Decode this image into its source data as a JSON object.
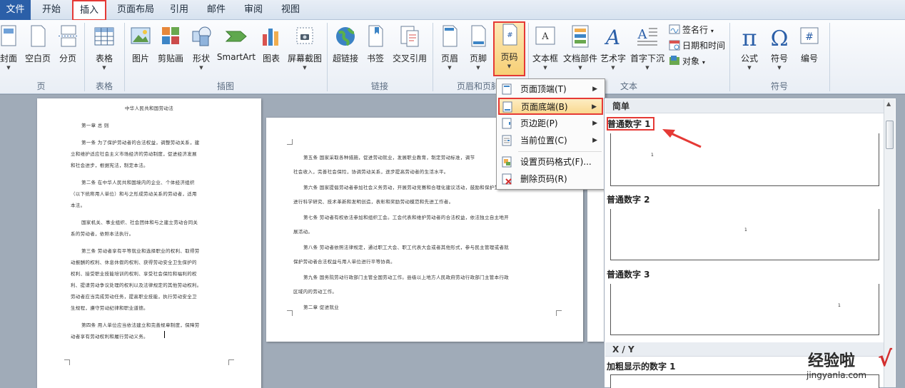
{
  "tabs": [
    "文件",
    "开始",
    "插入",
    "页面布局",
    "引用",
    "邮件",
    "审阅",
    "视图"
  ],
  "ribbon": {
    "page_group": {
      "label": "页",
      "cover": "封面",
      "blank": "空白页",
      "break": "分页"
    },
    "table_group": {
      "label": "表格",
      "table": "表格"
    },
    "illustrations_group": {
      "label": "插图",
      "picture": "图片",
      "clipart": "剪贴画",
      "shapes": "形状",
      "smartart": "SmartArt",
      "chart": "图表",
      "screenshot": "屏幕截图"
    },
    "links_group": {
      "label": "链接",
      "hyperlink": "超链接",
      "bookmark": "书签",
      "crossref": "交叉引用"
    },
    "hf_group": {
      "label": "页眉和页脚",
      "header": "页眉",
      "footer": "页脚",
      "pagenum": "页码"
    },
    "text_group": {
      "label": "文本",
      "textbox": "文本框",
      "quickparts": "文档部件",
      "wordart": "艺术字",
      "dropcap": "首字下沉",
      "signature": "签名行",
      "datetime": "日期和时间",
      "object": "对象"
    },
    "symbols_group": {
      "label": "符号",
      "equation": "公式",
      "symbol": "符号",
      "number": "编号"
    }
  },
  "page_num_menu": [
    {
      "label": "页面顶端(T)",
      "submenu": true
    },
    {
      "label": "页面底端(B)",
      "submenu": true,
      "highlighted": true
    },
    {
      "label": "页边距(P)",
      "submenu": true
    },
    {
      "label": "当前位置(C)",
      "submenu": true
    },
    {
      "label": "设置页码格式(F)...",
      "submenu": false
    },
    {
      "label": "删除页码(R)",
      "submenu": false
    }
  ],
  "gallery": {
    "section1": "简单",
    "items": [
      "普通数字 1",
      "普通数字 2",
      "普通数字 3"
    ],
    "section2": "X / Y",
    "item4": "加粗显示的数字 1",
    "thumb_number": "1"
  },
  "document": {
    "page1": [
      "中华人民共和国劳动法",
      "第一章  总  则",
      "第一条  为了保护劳动者的合法权益，调整劳动关系，建",
      "立和维护适应社会主义市场经济的劳动制度，促进经济发展",
      "和社会进步，根据宪法，制定本法。",
      "第二条  在中华人民共和国境内的企业、个体经济组织",
      "（以下统称用人单位）和与之形成劳动关系的劳动者，适用",
      "本法。",
      "国家机关、事业组织、社会团体和与之建立劳动合同关",
      "系的劳动者，依照本法执行。",
      "第三条  劳动者享有平等就业和选择职业的权利、取得劳",
      "动报酬的权利、休息休假的权利、获得劳动安全卫生保护的",
      "权利、接受职业技能培训的权利、享受社会保险和福利的权",
      "利、提请劳动争议处理的权利以及法律规定的其他劳动权利。",
      "劳动者应当完成劳动任务，提高职业技能，执行劳动安全卫",
      "生规程，遵守劳动纪律和职业道德。",
      "第四条  用人单位应当依法建立和完善规章制度，保障劳",
      "动者享有劳动权利和履行劳动义务。"
    ],
    "page2": [
      "第五条  国家采取各种措施，促进劳动就业，发展职业教育，制定劳动标准，调节",
      "社会收入，完善社会保险，协调劳动关系，逐步提高劳动者的生活水平。",
      "第六条  国家提倡劳动者参加社会义务劳动，开展劳动竞赛和合理化建议活动，鼓励和保护劳动者",
      "进行科学研究、技术革新和发明创造，表彰和奖励劳动模范和先进工作者。",
      "第七条  劳动者有权依法参加和组织工会。工会代表和维护劳动者的合法权益，依法独立自主地开",
      "展活动。",
      "第八条  劳动者依照法律规定，通过职工大会、职工代表大会或者其他形式，参与民主管理或者就",
      "保护劳动者合法权益与用人单位进行平等协商。",
      "第九条  国务院劳动行政部门主管全国劳动工作。县级以上地方人民政府劳动行政部门主管本行政",
      "区域内的劳动工作。",
      "第二章  促进就业"
    ]
  },
  "watermark": {
    "text": "经验啦",
    "url": "jingyanla.com",
    "mark": "√"
  },
  "colors": {
    "highlight_red": "#e53935",
    "file_tab": "#2b5fa8",
    "menu_highlight": "#f9d88d"
  }
}
